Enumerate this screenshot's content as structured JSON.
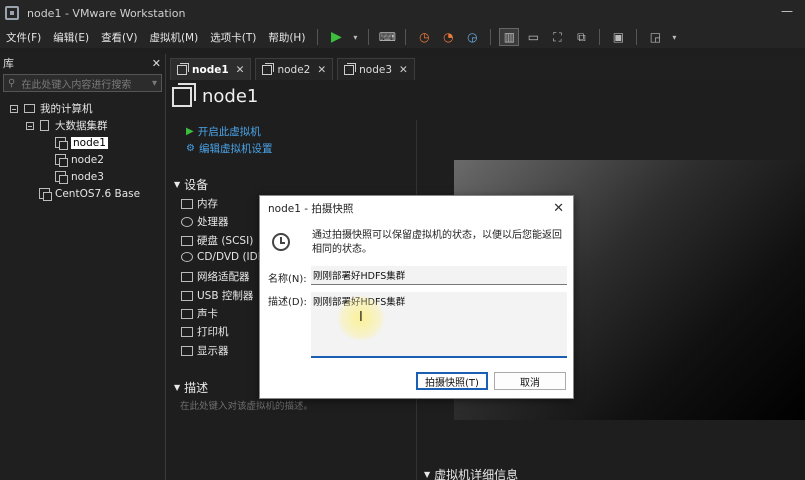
{
  "window": {
    "title": "node1 - VMware Workstation"
  },
  "menu": [
    "文件(F)",
    "编辑(E)",
    "查看(V)",
    "虚拟机(M)",
    "选项卡(T)",
    "帮助(H)"
  ],
  "library": {
    "title": "库",
    "search_placeholder": "在此处键入内容进行搜索",
    "tree": {
      "root": "我的计算机",
      "folder": "大数据集群",
      "vms": [
        "node1",
        "node2",
        "node3"
      ],
      "other": "CentOS7.6 Base"
    }
  },
  "tabs": [
    {
      "label": "node1"
    },
    {
      "label": "node2"
    },
    {
      "label": "node3"
    }
  ],
  "vm": {
    "name": "node1",
    "actions": {
      "power_on": "开启此虚拟机",
      "edit": "编辑虚拟机设置"
    },
    "devices_title": "设备",
    "devices": [
      "内存",
      "处理器",
      "硬盘 (SCSI)",
      "CD/DVD (IDE",
      "网络适配器",
      "USB 控制器",
      "声卡",
      "打印机",
      "显示器"
    ],
    "description_title": "描述",
    "description_hint": "在此处键入对该虚拟机的描述。",
    "details_title": "虚拟机详细信息"
  },
  "dialog": {
    "title": "node1 - 拍摄快照",
    "message": "通过拍摄快照可以保留虚拟机的状态，以便以后您能返回相同的状态。",
    "name_label": "名称(N):",
    "name_value": "刚刚部署好HDFS集群",
    "desc_label": "描述(D):",
    "desc_value": "刚刚部署好HDFS集群",
    "ok_label": "拍摄快照(T)",
    "cancel_label": "取消"
  }
}
